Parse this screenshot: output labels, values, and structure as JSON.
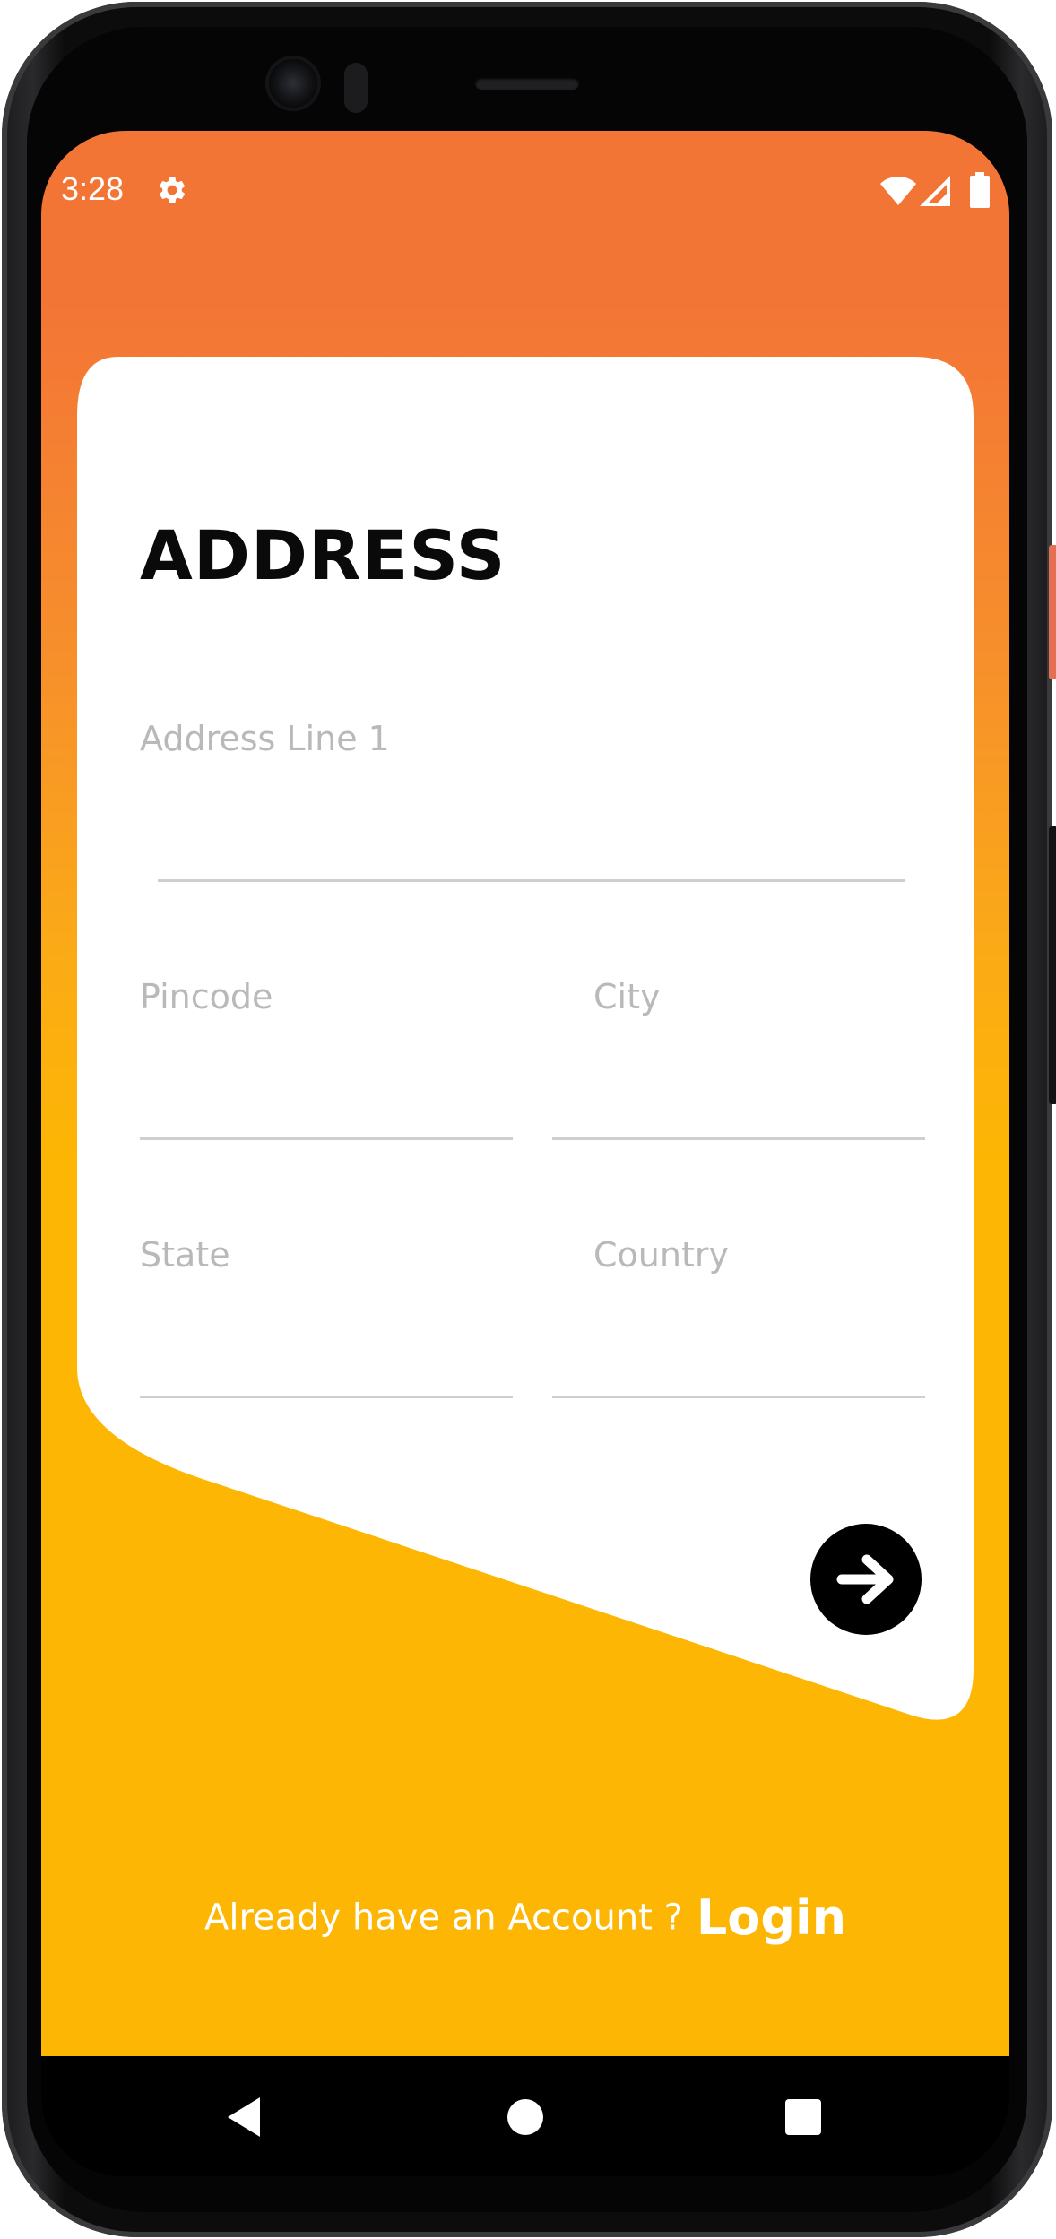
{
  "status_bar": {
    "time": "3:28",
    "settings_icon": "gear-icon",
    "wifi_icon": "wifi-icon",
    "signal_icon": "cell-signal-icon",
    "battery_icon": "battery-icon"
  },
  "form": {
    "title": "ADDRESS",
    "fields": {
      "address_line_1": "Address Line 1",
      "pincode": "Pincode",
      "city": "City",
      "state": "State",
      "country": "Country"
    },
    "next_icon": "arrow-right-icon"
  },
  "footer": {
    "prompt": "Already have an Account ?",
    "link": "Login"
  },
  "nav_bar": {
    "back_icon": "back-triangle-icon",
    "home_icon": "home-circle-icon",
    "recents_icon": "recents-square-icon"
  },
  "colors": {
    "gradient_top": "#f37536",
    "gradient_bottom": "#fdb603",
    "card": "#ffffff",
    "title": "#0a0a0a",
    "placeholder": "#b9b9b9",
    "button": "#000000"
  }
}
